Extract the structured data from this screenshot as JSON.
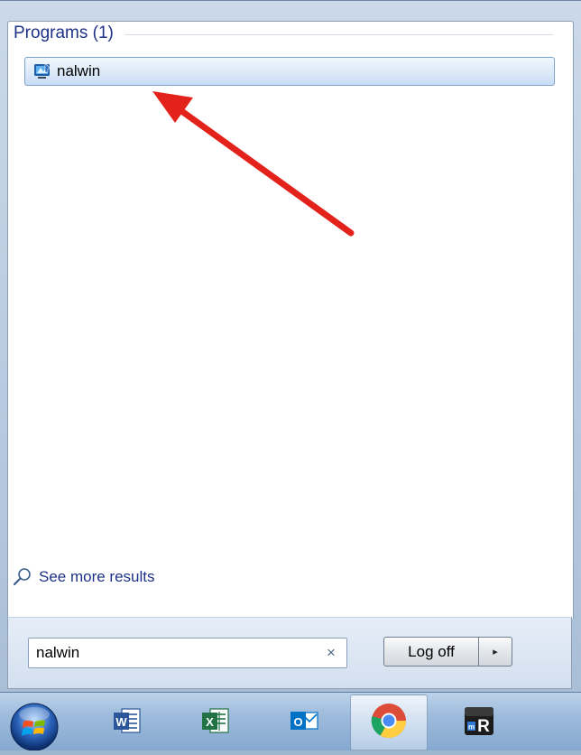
{
  "start_menu": {
    "section_title": "Programs (1)",
    "results": [
      {
        "label": "nalwin",
        "icon": "nalwin-app-icon"
      }
    ],
    "see_more_label": "See more results",
    "search": {
      "value": "nalwin",
      "clear_icon": "×"
    },
    "logoff_label": "Log off",
    "options_arrow": "▸"
  },
  "taskbar": {
    "start": "windows-start-orb",
    "apps": [
      {
        "name": "word",
        "icon": "word-icon",
        "letter": "W",
        "color": "#2b579a"
      },
      {
        "name": "excel",
        "icon": "excel-icon",
        "letter": "X",
        "color": "#217346"
      },
      {
        "name": "outlook",
        "icon": "outlook-icon",
        "letter": "O",
        "color": "#0072c6"
      },
      {
        "name": "chrome",
        "icon": "chrome-icon",
        "active": true
      },
      {
        "name": "mremoteng",
        "icon": "mr-icon",
        "letter": "mR"
      }
    ]
  },
  "colors": {
    "link_blue": "#1e3287",
    "annotation_arrow": "#e3231b",
    "selection_border": "#7da2ce"
  }
}
